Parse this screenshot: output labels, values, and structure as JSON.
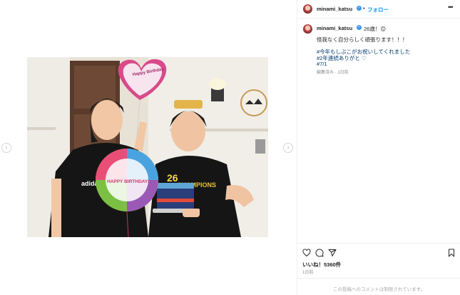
{
  "post": {
    "username": "minami_katsu",
    "follow_label": "フォロー",
    "separator": "•",
    "more_label": "•••",
    "caption": {
      "line1": "26歳！😊",
      "line2": "怪我なく自分らしく頑張ります！！！",
      "line3": "#今年もしぶこがお祝いしてくれました",
      "line4": "#2年連続ありがと ♡",
      "line5": "#7/1",
      "meta": "編集済み · 1日前"
    },
    "likes": "いいね！5360件",
    "time": "1日前",
    "comments_limited": "この投稿へのコメントは制限されています。"
  },
  "photo": {
    "balloon_top_text": "Happy Birthday",
    "balloon_front_text": "HAPPY BIRTHDAY!",
    "cake_number": "26",
    "shirt_left_text": "adidas",
    "shirt_right_text": "CHAMPIONS"
  },
  "icons": [
    "heart-icon",
    "comment-icon",
    "share-icon",
    "bookmark-icon",
    "more-icon",
    "verified-badge-icon",
    "chevron-left-icon",
    "chevron-right-icon"
  ],
  "colors": {
    "link_blue": "#0095f6",
    "hashtag_blue": "#00376b",
    "muted_gray": "#8e8e8e",
    "verified_blue": "#3897f0"
  }
}
